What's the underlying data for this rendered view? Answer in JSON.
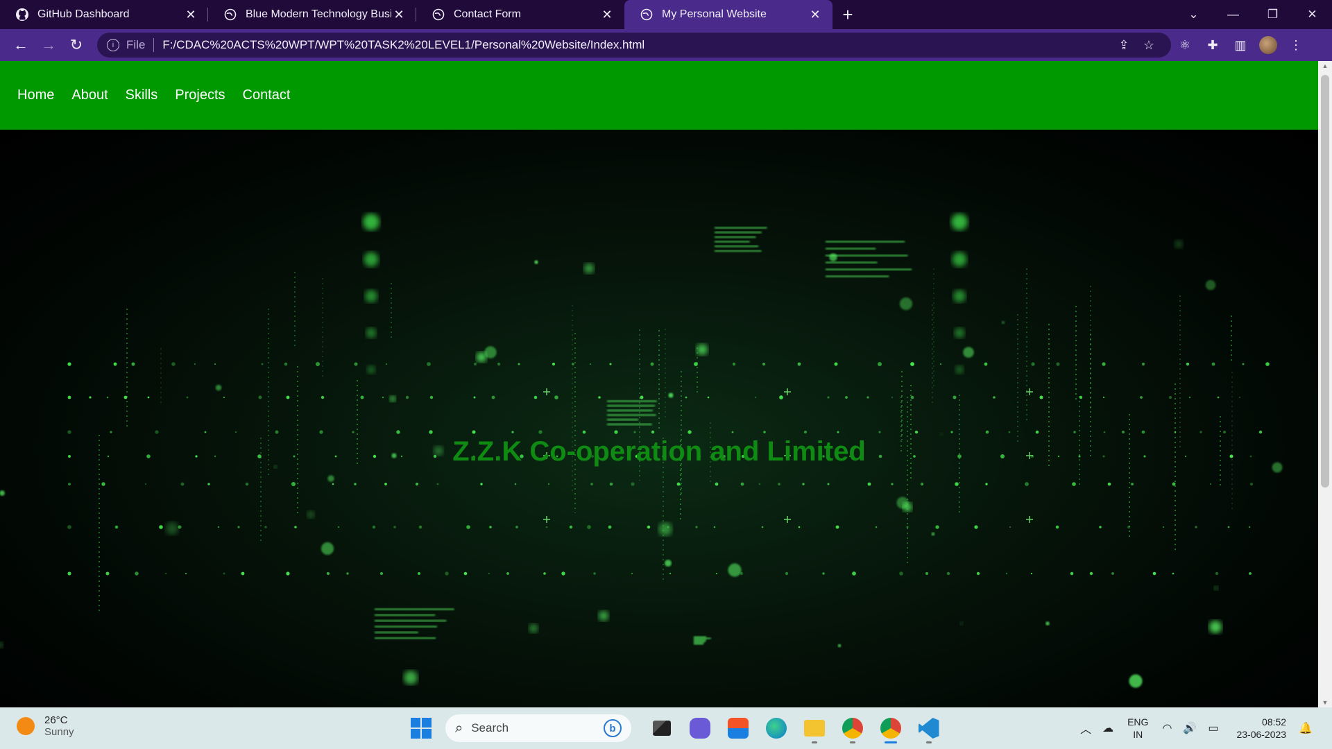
{
  "browser": {
    "tabs": [
      {
        "title": "GitHub Dashboard",
        "favicon": "github-icon",
        "active": false
      },
      {
        "title": "Blue Modern Technology Business",
        "favicon": "globe-icon",
        "active": false
      },
      {
        "title": "Contact Form",
        "favicon": "globe-icon",
        "active": false
      },
      {
        "title": "My Personal Website",
        "favicon": "globe-icon",
        "active": true
      }
    ],
    "address": {
      "scheme": "File",
      "url": "F:/CDAC%20ACTS%20WPT/WPT%20TASK2%20LEVEL1/Personal%20Website/Index.html"
    },
    "colors": {
      "tabstrip": "#1f0a3a",
      "toolbar": "#4a2a8a",
      "omnibox": "#2b1452"
    }
  },
  "page": {
    "nav": [
      "Home",
      "About",
      "Skills",
      "Projects",
      "Contact"
    ],
    "headline": "Z.Z.K Co-operation and Limited",
    "colors": {
      "navbar": "#009a00",
      "headline": "#0f8a12"
    }
  },
  "taskbar": {
    "weather": {
      "temp": "26°C",
      "condition": "Sunny"
    },
    "search_placeholder": "Search",
    "apps": [
      "task-view",
      "teams",
      "store",
      "edge",
      "file-explorer",
      "chrome",
      "chrome",
      "vscode"
    ],
    "language": {
      "line1": "ENG",
      "line2": "IN"
    },
    "clock": {
      "time": "08:52",
      "date": "23-06-2023"
    }
  }
}
